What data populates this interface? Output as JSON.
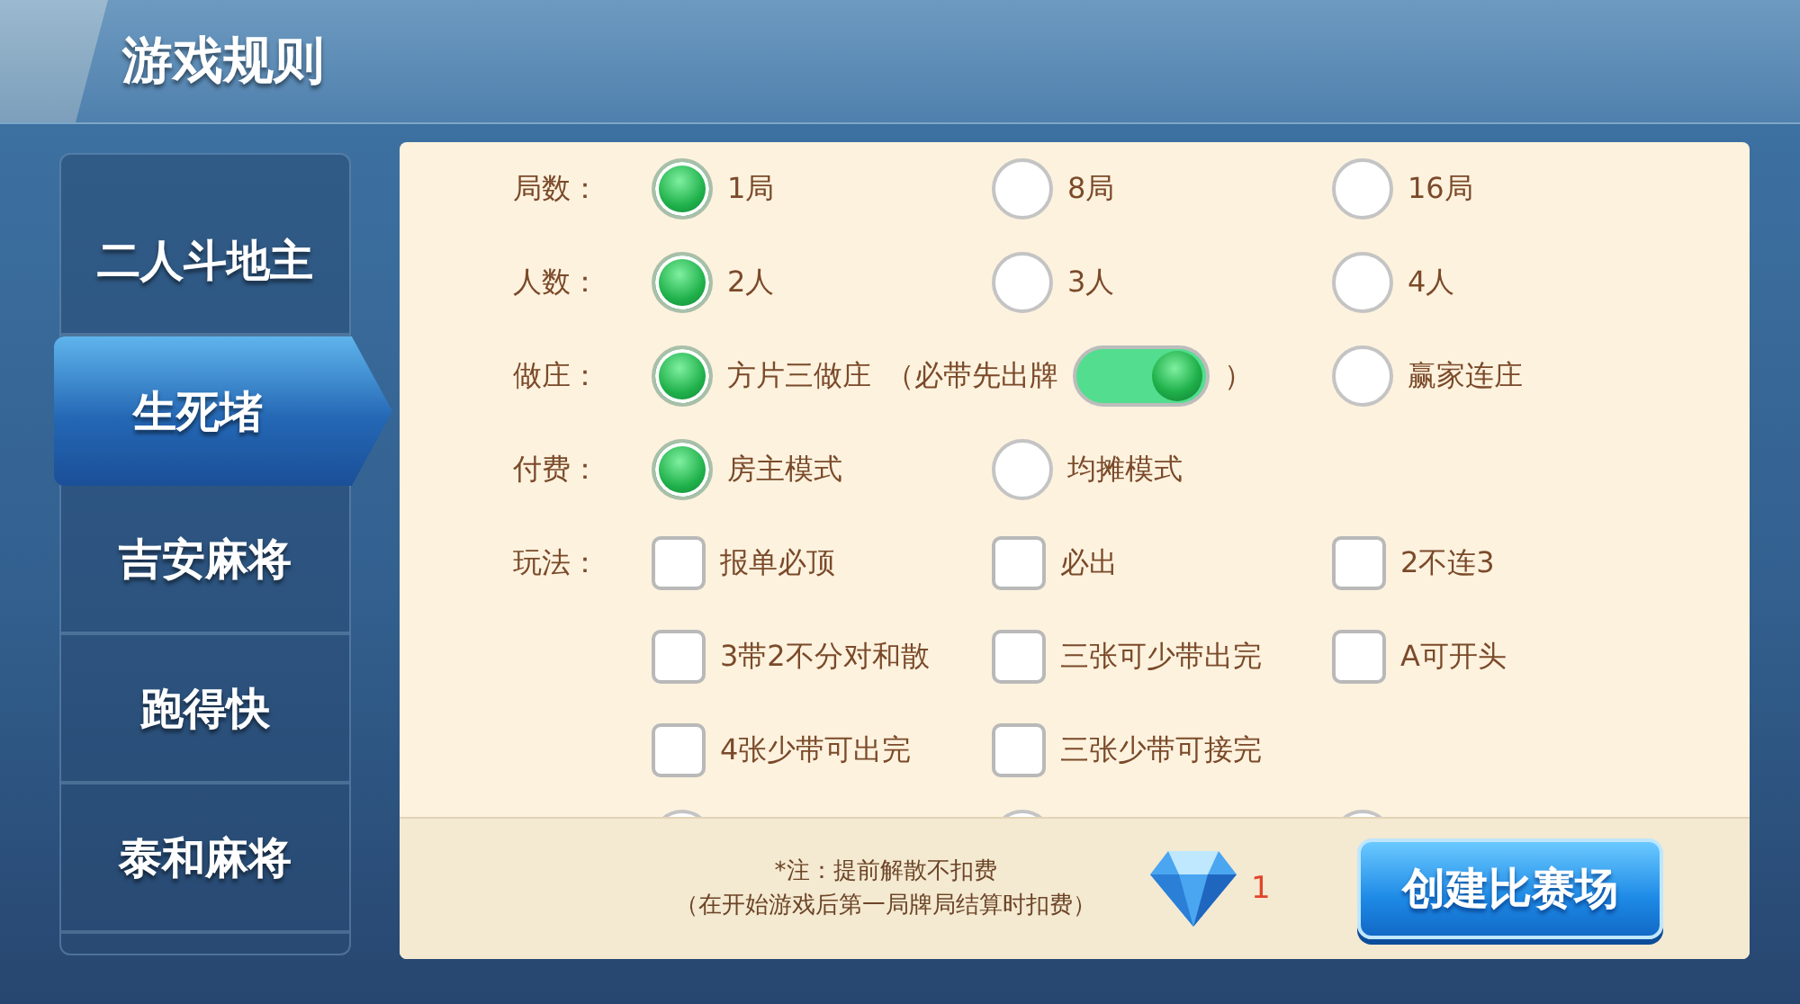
{
  "header": {
    "title": "游戏规则"
  },
  "sidebar": {
    "items": [
      {
        "label": "二人斗地主",
        "selected": false
      },
      {
        "label": "生死堵",
        "selected": true
      },
      {
        "label": "吉安麻将",
        "selected": false
      },
      {
        "label": "跑得快",
        "selected": false
      },
      {
        "label": "泰和麻将",
        "selected": false
      }
    ]
  },
  "settings": [
    {
      "kind": "radio",
      "label": "局数：",
      "options": [
        {
          "label": "1局",
          "selected": true
        },
        {
          "label": "8局",
          "selected": false
        },
        {
          "label": "16局",
          "selected": false
        }
      ]
    },
    {
      "kind": "radio",
      "label": "人数：",
      "options": [
        {
          "label": "2人",
          "selected": true
        },
        {
          "label": "3人",
          "selected": false
        },
        {
          "label": "4人",
          "selected": false
        }
      ]
    },
    {
      "kind": "radio",
      "label": "做庄：",
      "options": [
        {
          "label": "方片三做庄",
          "selected": true,
          "extra": {
            "before": "（必带先出牌",
            "on": true,
            "after": "）"
          }
        },
        {
          "label": "赢家连庄",
          "selected": false
        }
      ]
    },
    {
      "kind": "radio",
      "label": "付费：",
      "options": [
        {
          "label": "房主模式",
          "selected": true
        },
        {
          "label": "均摊模式",
          "selected": false
        }
      ]
    },
    {
      "kind": "check",
      "label": "玩法：",
      "options": [
        {
          "label": "报单必顶",
          "checked": false
        },
        {
          "label": "必出",
          "checked": false
        },
        {
          "label": "2不连3",
          "checked": false
        }
      ]
    },
    {
      "kind": "check",
      "options": [
        {
          "label": "3带2不分对和散",
          "checked": false
        },
        {
          "label": "三张可少带出完",
          "checked": false
        },
        {
          "label": "A可开头",
          "checked": false
        }
      ]
    },
    {
      "kind": "check",
      "options": [
        {
          "label": "4张少带可出完",
          "checked": false
        },
        {
          "label": "三张少带可接完",
          "checked": false
        }
      ]
    },
    {
      "kind": "clipped"
    }
  ],
  "footer": {
    "note": [
      "*注：提前解散不扣费",
      "（在开始游戏后第一局牌局结算时扣费）"
    ],
    "cost": "1",
    "button": "创建比赛场"
  }
}
